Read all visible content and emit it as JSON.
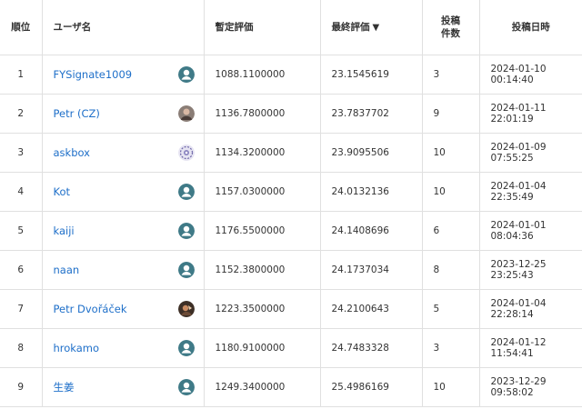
{
  "headers": {
    "rank": "順位",
    "user": "ユーザ名",
    "provisional": "暫定評価",
    "final": "最終評価",
    "sort_arrow": "▼",
    "count_line1": "投稿",
    "count_line2": "件数",
    "date": "投稿日時"
  },
  "rows": [
    {
      "rank": "1",
      "user": "FYSignate1009",
      "avatar": "default",
      "provisional": "1088.1100000",
      "final": "23.1545619",
      "count": "3",
      "date": "2024-01-10 00:14:40"
    },
    {
      "rank": "2",
      "user": "Petr (CZ)",
      "avatar": "photo",
      "provisional": "1136.7800000",
      "final": "23.7837702",
      "count": "9",
      "date": "2024-01-11 22:01:19"
    },
    {
      "rank": "3",
      "user": "askbox",
      "avatar": "pattern",
      "provisional": "1134.3200000",
      "final": "23.9095506",
      "count": "10",
      "date": "2024-01-09 07:55:25"
    },
    {
      "rank": "4",
      "user": "Kot",
      "avatar": "default",
      "provisional": "1157.0300000",
      "final": "24.0132136",
      "count": "10",
      "date": "2024-01-04 22:35:49"
    },
    {
      "rank": "5",
      "user": "kaiji",
      "avatar": "default",
      "provisional": "1176.5500000",
      "final": "24.1408696",
      "count": "6",
      "date": "2024-01-01 08:04:36"
    },
    {
      "rank": "6",
      "user": "naan",
      "avatar": "default",
      "provisional": "1152.3800000",
      "final": "24.1737034",
      "count": "8",
      "date": "2023-12-25 23:25:43"
    },
    {
      "rank": "7",
      "user": "Petr Dvořáček",
      "avatar": "photo2",
      "provisional": "1223.3500000",
      "final": "24.2100643",
      "count": "5",
      "date": "2024-01-04 22:28:14"
    },
    {
      "rank": "8",
      "user": "hrokamo",
      "avatar": "default",
      "provisional": "1180.9100000",
      "final": "24.7483328",
      "count": "3",
      "date": "2024-01-12 11:54:41"
    },
    {
      "rank": "9",
      "user": "生姜",
      "avatar": "default",
      "provisional": "1249.3400000",
      "final": "25.4986169",
      "count": "10",
      "date": "2023-12-29 09:58:02"
    }
  ],
  "colors": {
    "link": "#1e6fc9",
    "avatar_default": "#3f7a87",
    "border": "#e0e0e0"
  }
}
